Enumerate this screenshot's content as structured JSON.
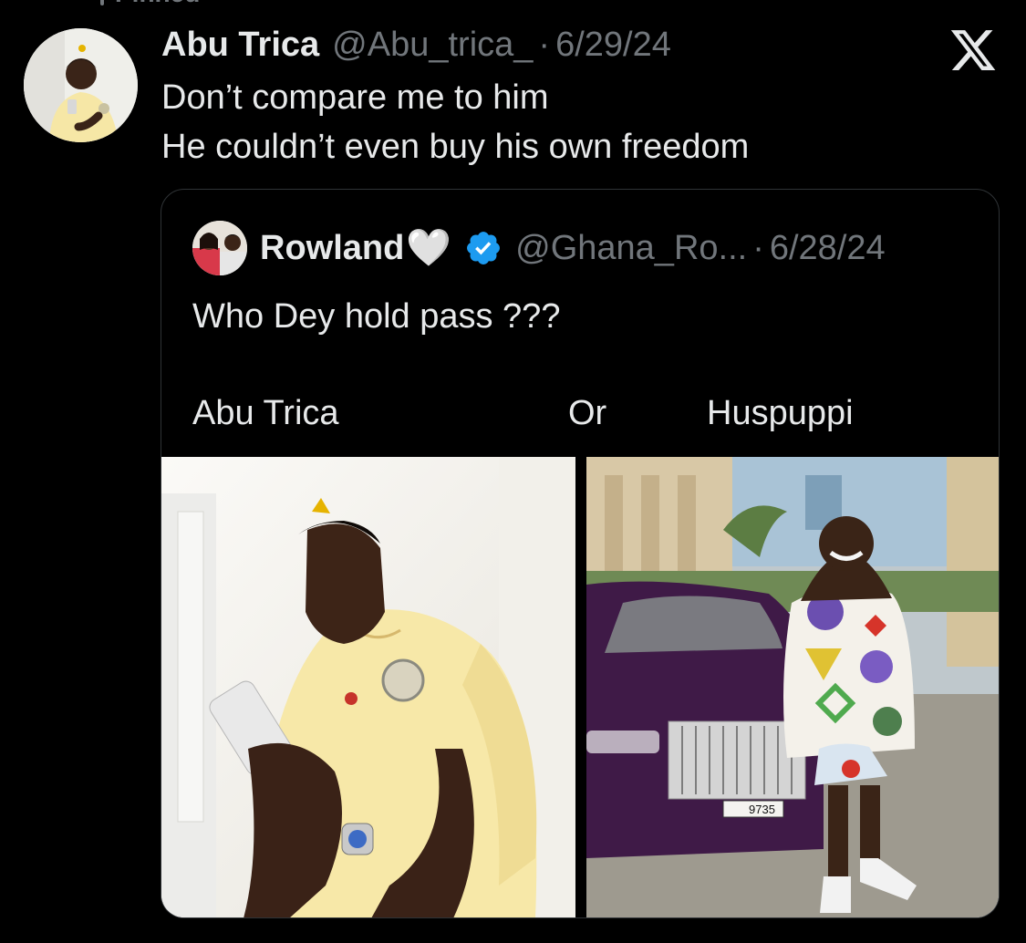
{
  "pinned": {
    "label": "Pinned"
  },
  "tweet": {
    "author_name": "Abu Trica",
    "author_handle": "@Abu_trica_",
    "separator": "·",
    "date": "6/29/24",
    "lines": [
      "Don’t compare me to him",
      "He couldn’t even buy his own freedom"
    ]
  },
  "quoted_tweet": {
    "author_name": "Rowland",
    "name_emoji": "🤍",
    "author_handle": "@Ghana_Ro...",
    "separator": "·",
    "date": "6/28/24",
    "text": "Who Dey hold pass ???",
    "poll_row": {
      "left": "Abu Trica",
      "middle": "Or",
      "right": "Huspuppi"
    },
    "media": {
      "left_plate": "9735"
    }
  },
  "icons": {
    "brand": "x-logo-icon",
    "verified": "verified-badge-icon"
  },
  "colors": {
    "background": "#000000",
    "text_primary": "#e7e9ea",
    "text_secondary": "#71767b",
    "verified_blue": "#1d9bf0",
    "border": "#2f3336"
  }
}
